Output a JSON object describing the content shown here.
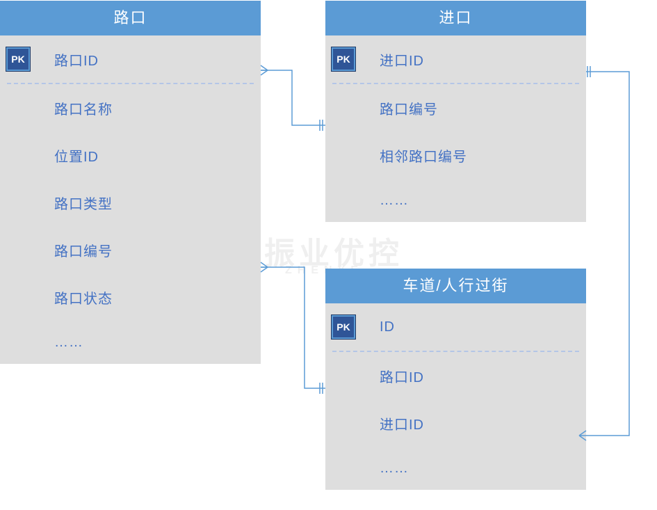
{
  "entities": {
    "intersection": {
      "title": "路口",
      "pk_badge": "PK",
      "attrs": [
        "路口ID",
        "路口名称",
        "位置ID",
        "路口类型",
        "路口编号",
        "路口状态",
        "……"
      ]
    },
    "approach": {
      "title": "进口",
      "pk_badge": "PK",
      "attrs": [
        "进口ID",
        "路口编号",
        "相邻路口编号",
        "……"
      ]
    },
    "lane": {
      "title": "车道/人行过街",
      "pk_badge": "PK",
      "attrs": [
        "ID",
        "路口ID",
        "进口ID",
        "……"
      ]
    }
  },
  "watermark": {
    "top": "ZHENYE",
    "cn": "振业优控",
    "en": "ZHENYE"
  }
}
